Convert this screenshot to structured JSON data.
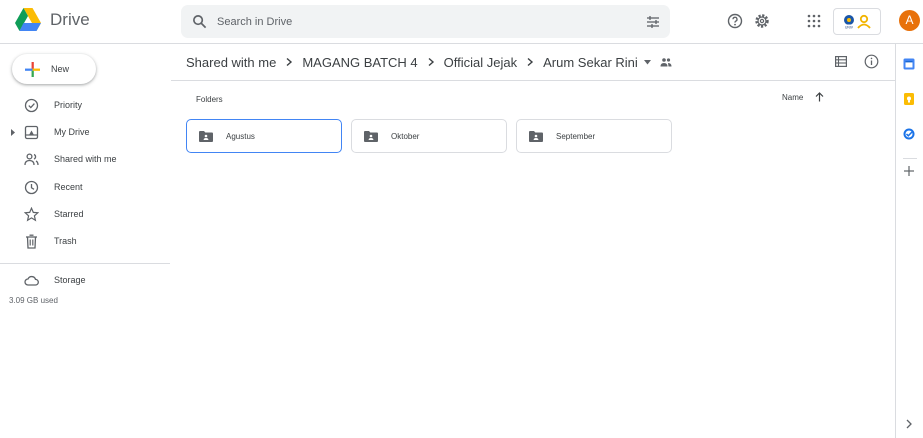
{
  "app": {
    "name": "Drive"
  },
  "search": {
    "placeholder": "Search in Drive"
  },
  "account": {
    "initial": "A",
    "avatar_color": "#e8710a",
    "org_badge": "UNIV"
  },
  "sidebar": {
    "new_label": "New",
    "items": [
      {
        "label": "Priority",
        "icon": "priority-icon"
      },
      {
        "label": "My Drive",
        "icon": "my-drive-icon"
      },
      {
        "label": "Shared with me",
        "icon": "shared-icon"
      },
      {
        "label": "Recent",
        "icon": "clock-icon"
      },
      {
        "label": "Starred",
        "icon": "star-icon"
      },
      {
        "label": "Trash",
        "icon": "trash-icon"
      }
    ],
    "storage": {
      "label": "Storage",
      "used": "3.09 GB used"
    }
  },
  "breadcrumb": [
    "Shared with me",
    "MAGANG BATCH 4",
    "Official Jejak",
    "Arum Sekar Rini"
  ],
  "main": {
    "folders_label": "Folders",
    "sort_label": "Name",
    "folders": [
      {
        "name": "Agustus",
        "selected": true
      },
      {
        "name": "Oktober",
        "selected": false
      },
      {
        "name": "September",
        "selected": false
      }
    ]
  },
  "colors": {
    "accent": "#1a73e8",
    "selected_border": "#4285f4",
    "text": "#3c4043",
    "icon": "#5f6368"
  }
}
